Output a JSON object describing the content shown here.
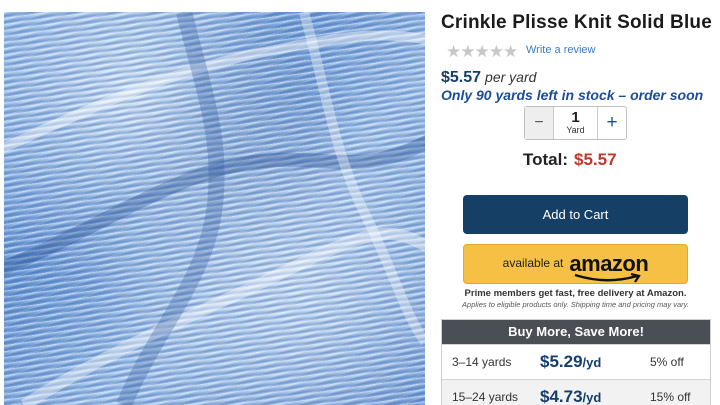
{
  "product": {
    "title": "Crinkle Plisse Knit Solid Blue",
    "image_alt": "Crinkle Plisse Knit Solid Blue fabric"
  },
  "rating": {
    "stars": "★★★★★",
    "write_review": "Write a review"
  },
  "pricing": {
    "price": "$5.57",
    "per_unit": "per yard",
    "stock_note": "Only 90 yards left in stock – order soon"
  },
  "quantity": {
    "minus": "−",
    "value": "1",
    "unit": "Yard",
    "plus": "+"
  },
  "total": {
    "label": "Total:",
    "amount": "$5.57"
  },
  "buttons": {
    "add_to_cart": "Add to Cart",
    "amazon_available": "available at",
    "amazon_logo": "amazon"
  },
  "notes": {
    "prime": "Prime members get fast, free delivery at Amazon.",
    "applies": "Applies to eligible products only. Shipping time and pricing may vary."
  },
  "bulk": {
    "header": "Buy More, Save More!",
    "rows": [
      {
        "range": "3–14 yards",
        "price": "$5.29",
        "unit": "/yd",
        "discount": "5% off"
      },
      {
        "range": "15–24 yards",
        "price": "$4.73",
        "unit": "/yd",
        "discount": "15% off"
      }
    ]
  },
  "colors": {
    "navy": "#163f66",
    "amazon_yellow": "#f5c043",
    "total_red": "#c0392b",
    "stock_blue": "#1a4d9b"
  }
}
